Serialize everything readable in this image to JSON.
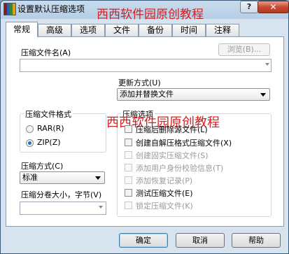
{
  "window": {
    "title": "设置默认压缩选项",
    "watermark": "西西软件园原创教程",
    "help_label": "?",
    "close_label": "✕"
  },
  "tabs": [
    {
      "label": "常规",
      "active": true
    },
    {
      "label": "高级",
      "active": false
    },
    {
      "label": "选项",
      "active": false
    },
    {
      "label": "文件",
      "active": false
    },
    {
      "label": "备份",
      "active": false
    },
    {
      "label": "时间",
      "active": false
    },
    {
      "label": "注释",
      "active": false
    }
  ],
  "general": {
    "archive_name_label": "压缩文件名(A)",
    "archive_name_value": "",
    "browse_label": "浏览(B)...",
    "update_mode_label": "更新方式(U)",
    "update_mode_value": "添加并替换文件",
    "format_group_label": "压缩文件格式",
    "format_options": [
      {
        "label": "RAR(R)",
        "selected": false
      },
      {
        "label": "ZIP(Z)",
        "selected": true
      }
    ],
    "method_label": "压缩方式(C)",
    "method_value": "标准",
    "split_label": "压缩分卷大小，字节(V)",
    "split_value": "",
    "options_group_label": "压缩选项",
    "options_watermark": "西西软件园原创教程",
    "options": [
      {
        "label": "压缩后删除源文件(L)",
        "checked": false,
        "enabled": true
      },
      {
        "label": "创建自解压格式压缩文件(X)",
        "checked": false,
        "enabled": true
      },
      {
        "label": "创建固实压缩文件(S)",
        "checked": false,
        "enabled": false
      },
      {
        "label": "添加用户身份校验信息(T)",
        "checked": false,
        "enabled": false
      },
      {
        "label": "添加恢复记录(P)",
        "checked": false,
        "enabled": false
      },
      {
        "label": "测试压缩文件(E)",
        "checked": false,
        "enabled": true
      },
      {
        "label": "锁定压缩文件(K)",
        "checked": false,
        "enabled": false
      }
    ]
  },
  "buttons": {
    "ok": "确定",
    "cancel": "取消",
    "help": "帮助"
  },
  "colors": {
    "watermark": "#d32020",
    "radio_selected": "#2d6bb8"
  }
}
